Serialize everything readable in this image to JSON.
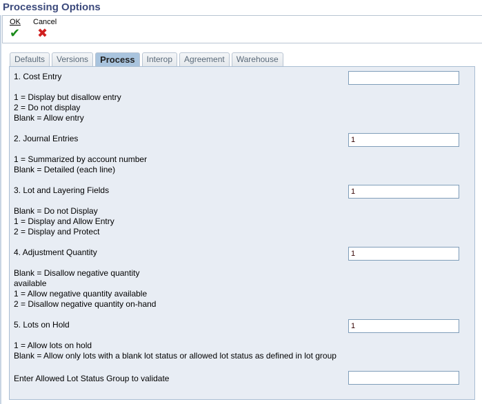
{
  "title": "Processing Options",
  "toolbar": {
    "ok_label": "OK",
    "cancel_label": "Cancel",
    "ok_icon": "check-icon",
    "cancel_icon": "x-icon",
    "ok_color": "#1a8a1a",
    "cancel_color": "#d02020"
  },
  "tabs": [
    {
      "label": "Defaults"
    },
    {
      "label": "Versions"
    },
    {
      "label": "Process",
      "active": true
    },
    {
      "label": "Interop"
    },
    {
      "label": "Agreement"
    },
    {
      "label": "Warehouse"
    }
  ],
  "options": [
    {
      "label": "1. Cost Entry",
      "value": "",
      "lines": [
        "1 = Display but disallow entry",
        "2 = Do not display",
        "Blank = Allow entry"
      ]
    },
    {
      "label": "2. Journal Entries",
      "value": "1",
      "lines": [
        "1 = Summarized by account number",
        "Blank = Detailed (each line)"
      ]
    },
    {
      "label": "3. Lot and Layering Fields",
      "value": "1",
      "lines": [
        "Blank = Do not Display",
        "1 = Display and Allow Entry",
        "2 = Display and Protect"
      ]
    },
    {
      "label": "4. Adjustment Quantity",
      "value": "1",
      "lines": [
        "Blank = Disallow negative quantity",
        "available",
        "1 = Allow negative quantity available",
        "2 = Disallow negative quantity on-hand"
      ]
    },
    {
      "label": "5. Lots on Hold",
      "value": "1",
      "lines": [
        "1 = Allow lots on hold",
        "Blank = Allow only lots with a blank lot status or allowed lot status as defined in lot group"
      ]
    },
    {
      "label": "Enter Allowed Lot Status Group to validate",
      "value": "",
      "lines": []
    }
  ]
}
